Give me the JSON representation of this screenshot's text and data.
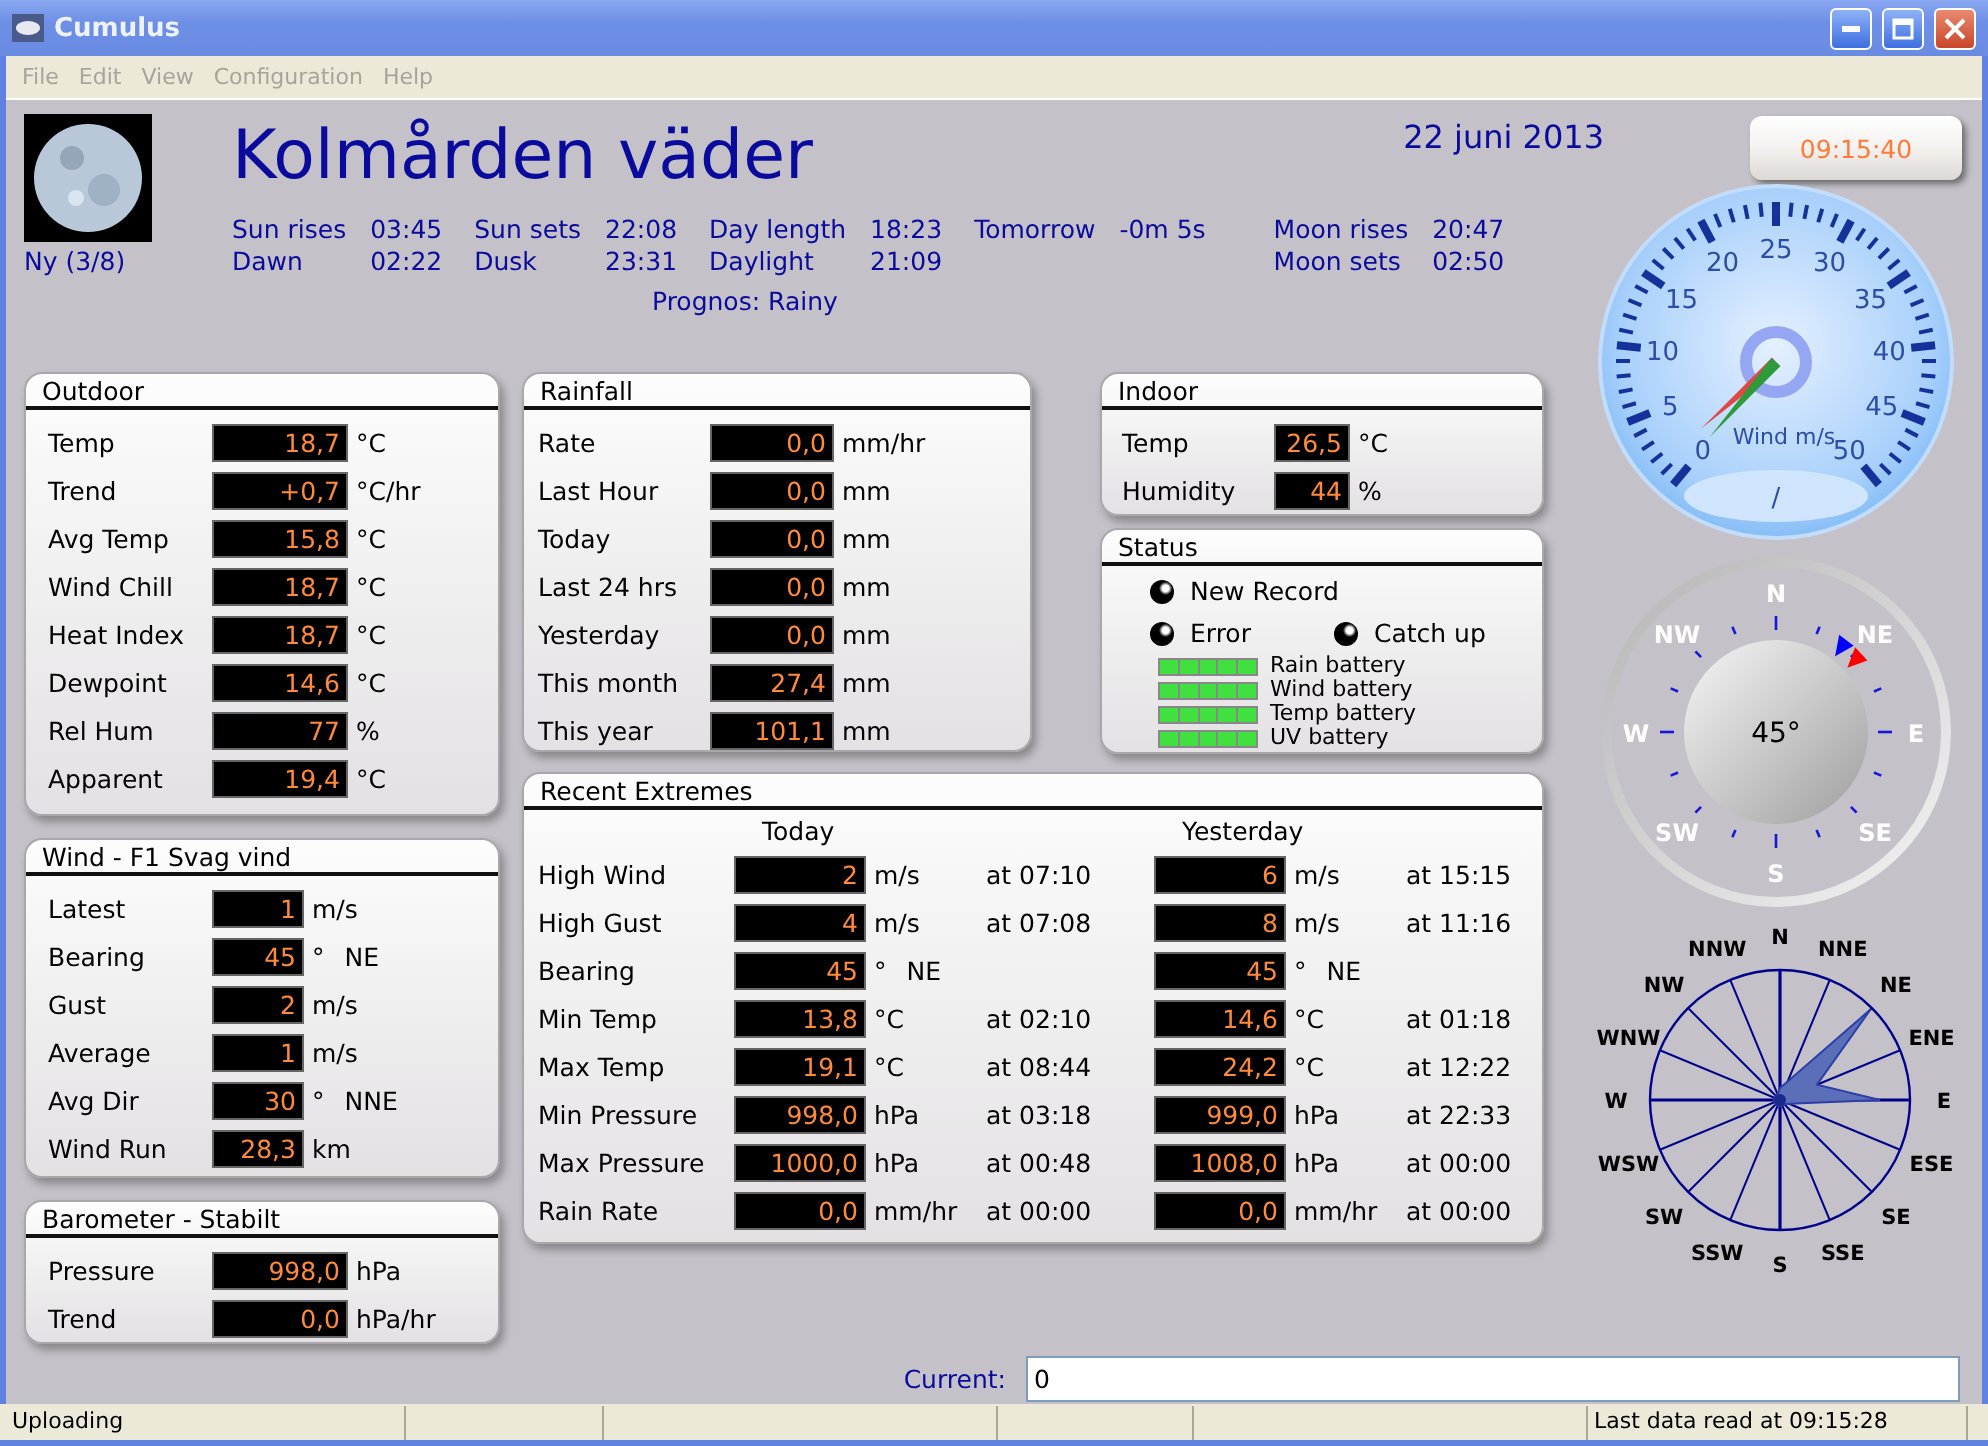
{
  "window": {
    "title": "Cumulus"
  },
  "menu": [
    {
      "label": "File",
      "disabled": true
    },
    {
      "label": "Edit",
      "disabled": true
    },
    {
      "label": "View",
      "disabled": true
    },
    {
      "label": "Configuration",
      "disabled": true
    },
    {
      "label": "Help",
      "disabled": true
    }
  ],
  "header": {
    "moon_phase": "Ny (3/8)",
    "station": "Kolmården väder",
    "date": "22 juni 2013",
    "forecast": "Prognos: Rainy",
    "almanac": [
      {
        "entries": [
          {
            "label": "Sun rises",
            "value": "03:45"
          },
          {
            "label": "Dawn",
            "value": "02:22"
          }
        ]
      },
      {
        "entries": [
          {
            "label": "Sun sets",
            "value": "22:08"
          },
          {
            "label": "Dusk",
            "value": "23:31"
          }
        ]
      },
      {
        "entries": [
          {
            "label": "Day length",
            "value": "18:23"
          },
          {
            "label": "Daylight",
            "value": "21:09"
          }
        ]
      },
      {
        "entries": [
          {
            "label": "Tomorrow",
            "value": "-0m 5s"
          }
        ]
      },
      {
        "entries": [
          {
            "label": "Moon rises",
            "value": "20:47"
          },
          {
            "label": "Moon sets",
            "value": "02:50"
          }
        ]
      }
    ]
  },
  "outdoor": {
    "title": "Outdoor",
    "rows": [
      {
        "label": "Temp",
        "value": "18,7",
        "unit": "°C"
      },
      {
        "label": "Trend",
        "value": "+0,7",
        "unit": "°C/hr"
      },
      {
        "label": "Avg Temp",
        "value": "15,8",
        "unit": "°C"
      },
      {
        "label": "Wind Chill",
        "value": "18,7",
        "unit": "°C"
      },
      {
        "label": "Heat Index",
        "value": "18,7",
        "unit": "°C"
      },
      {
        "label": "Dewpoint",
        "value": "14,6",
        "unit": "°C"
      },
      {
        "label": "Rel Hum",
        "value": "77",
        "unit": "%"
      },
      {
        "label": "Apparent",
        "value": "19,4",
        "unit": "°C"
      }
    ]
  },
  "wind": {
    "title": "Wind - F1 Svag vind",
    "rows": [
      {
        "label": "Latest",
        "value": "1",
        "unit": "m/s"
      },
      {
        "label": "Bearing",
        "value": "45",
        "unit": "°",
        "note": "NE"
      },
      {
        "label": "Gust",
        "value": "2",
        "unit": "m/s"
      },
      {
        "label": "Average",
        "value": "1",
        "unit": "m/s"
      },
      {
        "label": "Avg Dir",
        "value": "30",
        "unit": "°",
        "note": "NNE"
      },
      {
        "label": "Wind Run",
        "value": "28,3",
        "unit": "km"
      }
    ]
  },
  "barometer": {
    "title": "Barometer - Stabilt",
    "rows": [
      {
        "label": "Pressure",
        "value": "998,0",
        "unit": "hPa"
      },
      {
        "label": "Trend",
        "value": "0,0",
        "unit": "hPa/hr"
      }
    ]
  },
  "rainfall": {
    "title": "Rainfall",
    "rows": [
      {
        "label": "Rate",
        "value": "0,0",
        "unit": "mm/hr"
      },
      {
        "label": "Last Hour",
        "value": "0,0",
        "unit": "mm"
      },
      {
        "label": "Today",
        "value": "0,0",
        "unit": "mm"
      },
      {
        "label": "Last 24 hrs",
        "value": "0,0",
        "unit": "mm"
      },
      {
        "label": "Yesterday",
        "value": "0,0",
        "unit": "mm"
      },
      {
        "label": "This month",
        "value": "27,4",
        "unit": "mm"
      },
      {
        "label": "This year",
        "value": "101,1",
        "unit": "mm"
      }
    ]
  },
  "indoor": {
    "title": "Indoor",
    "rows": [
      {
        "label": "Temp",
        "value": "26,5",
        "unit": "°C"
      },
      {
        "label": "Humidity",
        "value": "44",
        "unit": "%"
      }
    ]
  },
  "status": {
    "title": "Status",
    "leds": [
      {
        "label": "New Record",
        "on": false
      },
      {
        "label": "Error",
        "on": false
      },
      {
        "label": "Catch up",
        "on": false
      }
    ],
    "batteries": [
      {
        "label": "Rain battery",
        "level": 1
      },
      {
        "label": "Wind battery",
        "level": 1
      },
      {
        "label": "Temp battery",
        "level": 1
      },
      {
        "label": "UV battery",
        "level": 1
      }
    ]
  },
  "extremes": {
    "title": "Recent Extremes",
    "columns": [
      "Today",
      "Yesterday"
    ],
    "rows": [
      {
        "label": "High Wind",
        "today": {
          "value": "2",
          "unit": "m/s",
          "time": "at 07:10"
        },
        "yesterday": {
          "value": "6",
          "unit": "m/s",
          "time": "at 15:15"
        }
      },
      {
        "label": "High Gust",
        "today": {
          "value": "4",
          "unit": "m/s",
          "time": "at 07:08"
        },
        "yesterday": {
          "value": "8",
          "unit": "m/s",
          "time": "at 11:16"
        }
      },
      {
        "label": "Bearing",
        "today": {
          "value": "45",
          "unit": "°",
          "note": "NE"
        },
        "yesterday": {
          "value": "45",
          "unit": "°",
          "note": "NE"
        }
      },
      {
        "label": "Min Temp",
        "today": {
          "value": "13,8",
          "unit": "°C",
          "time": "at 02:10"
        },
        "yesterday": {
          "value": "14,6",
          "unit": "°C",
          "time": "at 01:18"
        }
      },
      {
        "label": "Max Temp",
        "today": {
          "value": "19,1",
          "unit": "°C",
          "time": "at 08:44"
        },
        "yesterday": {
          "value": "24,2",
          "unit": "°C",
          "time": "at 12:22"
        }
      },
      {
        "label": "Min Pressure",
        "today": {
          "value": "998,0",
          "unit": "hPa",
          "time": "at 03:18"
        },
        "yesterday": {
          "value": "999,0",
          "unit": "hPa",
          "time": "at 22:33"
        }
      },
      {
        "label": "Max Pressure",
        "today": {
          "value": "1000,0",
          "unit": "hPa",
          "time": "at 00:48"
        },
        "yesterday": {
          "value": "1008,0",
          "unit": "hPa",
          "time": "at 00:00"
        }
      },
      {
        "label": "Rain Rate",
        "today": {
          "value": "0,0",
          "unit": "mm/hr",
          "time": "at 00:00"
        },
        "yesterday": {
          "value": "0,0",
          "unit": "mm/hr",
          "time": "at 00:00"
        }
      }
    ]
  },
  "clock": "09:15:40",
  "wind_gauge": {
    "label": "Wind m/s",
    "scale": [
      "25",
      "20",
      "30",
      "15",
      "35",
      "10",
      "40",
      "5",
      "45",
      "0",
      "50"
    ],
    "readout": "/",
    "needles": [
      {
        "color": "#e04848"
      },
      {
        "color": "#2f9a3a"
      }
    ]
  },
  "compass": {
    "reading": "45°",
    "points": [
      "N",
      "NE",
      "E",
      "SE",
      "S",
      "SW",
      "W",
      "NW"
    ],
    "pointers": [
      {
        "color": "#0000ff"
      },
      {
        "color": "#ff0000"
      }
    ]
  },
  "wind_rose": {
    "points": [
      "N",
      "NNW",
      "NNE",
      "NW",
      "NE",
      "WNW",
      "ENE",
      "W",
      "E",
      "WSW",
      "ESE",
      "SW",
      "SE",
      "SSW",
      "SSE",
      "S"
    ]
  },
  "current": {
    "label": "Current:",
    "value": "0"
  },
  "status_bar": {
    "left": "Uploading",
    "right": "Last data read at 09:15:28"
  }
}
